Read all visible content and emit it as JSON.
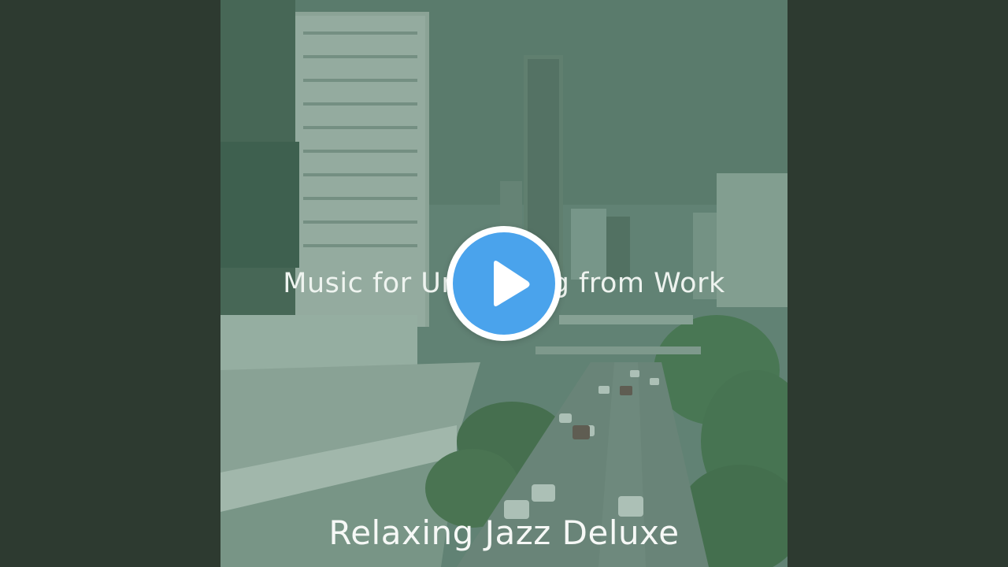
{
  "player": {
    "track_title": "Music for Unwinding from Work",
    "artist": "Relaxing Jazz Deluxe",
    "play_icon": "play-icon",
    "accent_color": "#4aa3ec",
    "background_color": "#2d3a30"
  }
}
